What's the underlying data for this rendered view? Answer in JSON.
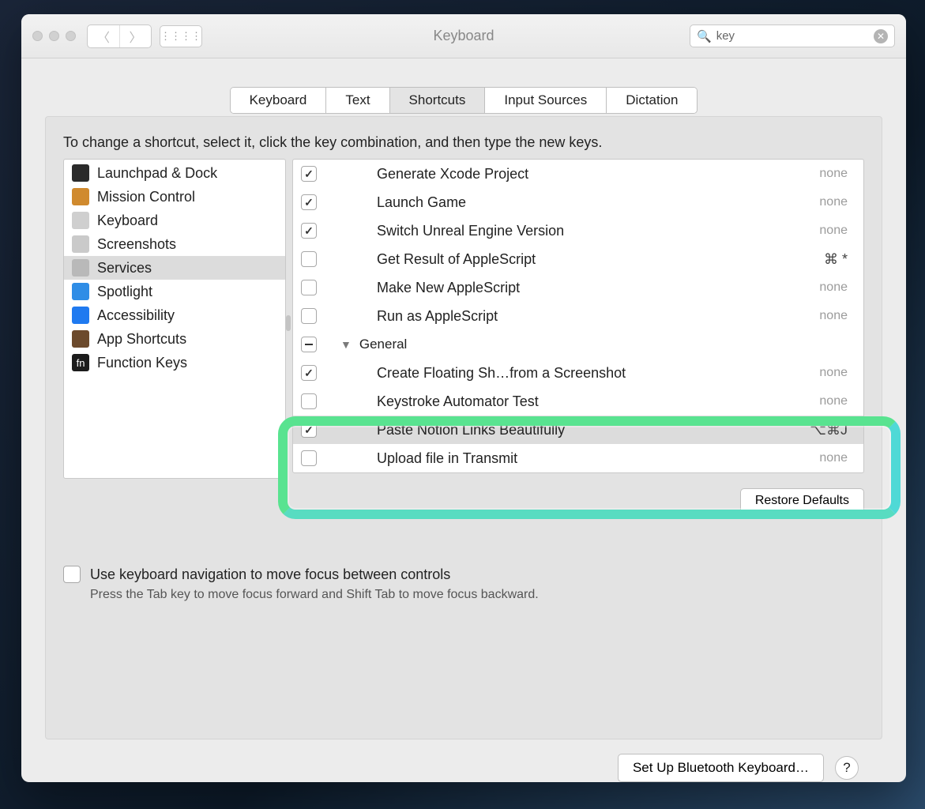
{
  "window": {
    "title": "Keyboard"
  },
  "search": {
    "value": "key"
  },
  "tabs": [
    "Keyboard",
    "Text",
    "Shortcuts",
    "Input Sources",
    "Dictation"
  ],
  "activeTab": "Shortcuts",
  "hint": "To change a shortcut, select it, click the key combination, and then type the new keys.",
  "sidebar": [
    {
      "label": "Launchpad & Dock",
      "iconBg": "#2b2b2b"
    },
    {
      "label": "Mission Control",
      "iconBg": "#d08a2e"
    },
    {
      "label": "Keyboard",
      "iconBg": "#cfcfcf"
    },
    {
      "label": "Screenshots",
      "iconBg": "#cacaca"
    },
    {
      "label": "Services",
      "iconBg": "#b9b9b9",
      "selected": true
    },
    {
      "label": "Spotlight",
      "iconBg": "#2f8de6"
    },
    {
      "label": "Accessibility",
      "iconBg": "#1f7af0"
    },
    {
      "label": "App Shortcuts",
      "iconBg": "#6c4a2c"
    },
    {
      "label": "Function Keys",
      "iconBg": "#1c1c1c",
      "iconText": "fn"
    }
  ],
  "shortcuts": [
    {
      "type": "item",
      "indent": 2,
      "checked": true,
      "label": "Generate Xcode Project",
      "shortcut": "none"
    },
    {
      "type": "item",
      "indent": 2,
      "checked": true,
      "label": "Launch Game",
      "shortcut": "none"
    },
    {
      "type": "item",
      "indent": 2,
      "checked": true,
      "label": "Switch Unreal Engine Version",
      "shortcut": "none"
    },
    {
      "type": "item",
      "indent": 2,
      "checked": false,
      "label": "Get Result of AppleScript",
      "shortcut": "⌘ *"
    },
    {
      "type": "item",
      "indent": 2,
      "checked": false,
      "label": "Make New AppleScript",
      "shortcut": "none"
    },
    {
      "type": "item",
      "indent": 2,
      "checked": false,
      "label": "Run as AppleScript",
      "shortcut": "none"
    },
    {
      "type": "group",
      "checked": "mixed",
      "label": "General"
    },
    {
      "type": "item",
      "indent": 2,
      "checked": true,
      "label": "Create Floating Sh…from a Screenshot",
      "shortcut": "none"
    },
    {
      "type": "item",
      "indent": 2,
      "checked": false,
      "label": "Keystroke Automator Test",
      "shortcut": "none"
    },
    {
      "type": "item",
      "indent": 2,
      "checked": true,
      "label": "Paste Notion Links Beautifully",
      "shortcut": "⌥⌘J",
      "selected": true
    },
    {
      "type": "item",
      "indent": 2,
      "checked": false,
      "label": "Upload file in Transmit",
      "shortcut": "none"
    }
  ],
  "restoreLabel": "Restore Defaults",
  "kbNavLabel": "Use keyboard navigation to move focus between controls",
  "kbNavSub": "Press the Tab key to move focus forward and Shift Tab to move focus backward.",
  "bluetoothLabel": "Set Up Bluetooth Keyboard…"
}
